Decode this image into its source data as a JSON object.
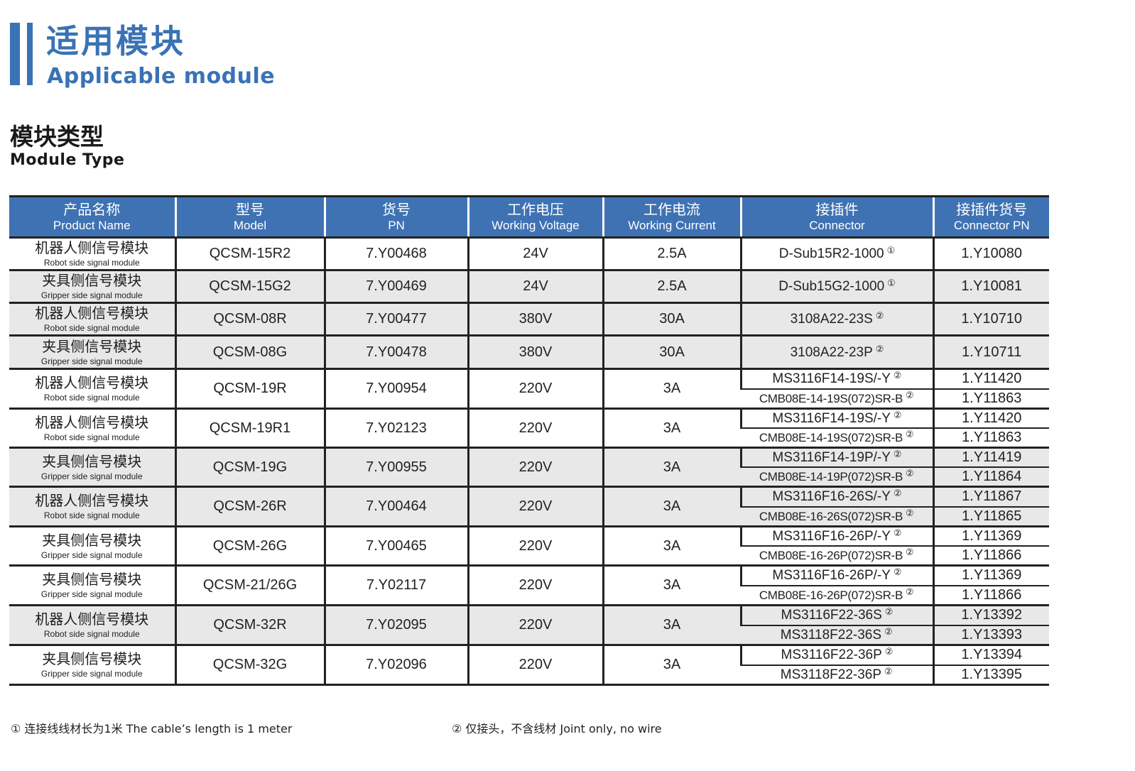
{
  "header": {
    "title_cn": "适用模块",
    "title_en": "Applicable module",
    "section_cn": "模块类型",
    "section_en": "Module Type"
  },
  "table": {
    "columns": [
      {
        "cn": "产品名称",
        "en": "Product Name"
      },
      {
        "cn": "型号",
        "en": "Model"
      },
      {
        "cn": "货号",
        "en": "PN"
      },
      {
        "cn": "工作电压",
        "en": "Working Voltage"
      },
      {
        "cn": "工作电流",
        "en": "Working Current"
      },
      {
        "cn": "接插件",
        "en": "Connector"
      },
      {
        "cn": "接插件货号",
        "en": "Connector PN"
      }
    ],
    "rows": [
      {
        "name_cn": "机器人侧信号模块",
        "name_en": "Robot side signal module",
        "model": "QCSM-15R2",
        "pn": "7.Y00468",
        "voltage": "24V",
        "current": "2.5A",
        "connectors": [
          {
            "name": "D-Sub15R2-1000",
            "note": "①",
            "pn": "1.Y10080"
          }
        ]
      },
      {
        "name_cn": "夹具侧信号模块",
        "name_en": "Gripper side signal module",
        "model": "QCSM-15G2",
        "pn": "7.Y00469",
        "voltage": "24V",
        "current": "2.5A",
        "connectors": [
          {
            "name": "D-Sub15G2-1000",
            "note": "①",
            "pn": "1.Y10081"
          }
        ]
      },
      {
        "name_cn": "机器人侧信号模块",
        "name_en": "Robot side signal module",
        "model": "QCSM-08R",
        "pn": "7.Y00477",
        "voltage": "380V",
        "current": "30A",
        "connectors": [
          {
            "name": "3108A22-23S",
            "note": "②",
            "pn": "1.Y10710"
          }
        ]
      },
      {
        "name_cn": "夹具侧信号模块",
        "name_en": "Gripper side signal module",
        "model": "QCSM-08G",
        "pn": "7.Y00478",
        "voltage": "380V",
        "current": "30A",
        "connectors": [
          {
            "name": "3108A22-23P",
            "note": "②",
            "pn": "1.Y10711"
          }
        ]
      },
      {
        "name_cn": "机器人侧信号模块",
        "name_en": "Robot side signal module",
        "model": "QCSM-19R",
        "pn": "7.Y00954",
        "voltage": "220V",
        "current": "3A",
        "connectors": [
          {
            "name": "MS3116F14-19S/-Y",
            "note": "②",
            "pn": "1.Y11420"
          },
          {
            "name": "CMB08E-14-19S(072)SR-B",
            "note": "②",
            "pn": "1.Y11863"
          }
        ]
      },
      {
        "name_cn": "机器人侧信号模块",
        "name_en": "Robot side signal module",
        "model": "QCSM-19R1",
        "pn": "7.Y02123",
        "voltage": "220V",
        "current": "3A",
        "connectors": [
          {
            "name": "MS3116F14-19S/-Y",
            "note": "②",
            "pn": "1.Y11420"
          },
          {
            "name": "CMB08E-14-19S(072)SR-B",
            "note": "②",
            "pn": "1.Y11863"
          }
        ]
      },
      {
        "name_cn": "夹具侧信号模块",
        "name_en": "Gripper side signal module",
        "model": "QCSM-19G",
        "pn": "7.Y00955",
        "voltage": "220V",
        "current": "3A",
        "connectors": [
          {
            "name": "MS3116F14-19P/-Y",
            "note": "②",
            "pn": "1.Y11419"
          },
          {
            "name": "CMB08E-14-19P(072)SR-B",
            "note": "②",
            "pn": "1.Y11864"
          }
        ]
      },
      {
        "name_cn": "机器人侧信号模块",
        "name_en": "Robot side signal module",
        "model": "QCSM-26R",
        "pn": "7.Y00464",
        "voltage": "220V",
        "current": "3A",
        "connectors": [
          {
            "name": "MS3116F16-26S/-Y",
            "note": "②",
            "pn": "1.Y11867"
          },
          {
            "name": "CMB08E-16-26S(072)SR-B",
            "note": "②",
            "pn": "1.Y11865"
          }
        ]
      },
      {
        "name_cn": "夹具侧信号模块",
        "name_en": "Gripper side signal module",
        "model": "QCSM-26G",
        "pn": "7.Y00465",
        "voltage": "220V",
        "current": "3A",
        "connectors": [
          {
            "name": "MS3116F16-26P/-Y",
            "note": "②",
            "pn": "1.Y11369"
          },
          {
            "name": "CMB08E-16-26P(072)SR-B",
            "note": "②",
            "pn": "1.Y11866"
          }
        ]
      },
      {
        "name_cn": "夹具侧信号模块",
        "name_en": "Gripper side signal module",
        "model": "QCSM-21/26G",
        "pn": "7.Y02117",
        "voltage": "220V",
        "current": "3A",
        "connectors": [
          {
            "name": "MS3116F16-26P/-Y",
            "note": "②",
            "pn": "1.Y11369"
          },
          {
            "name": "CMB08E-16-26P(072)SR-B",
            "note": "②",
            "pn": "1.Y11866"
          }
        ]
      },
      {
        "name_cn": "机器人侧信号模块",
        "name_en": "Robot side signal module",
        "model": "QCSM-32R",
        "pn": "7.Y02095",
        "voltage": "220V",
        "current": "3A",
        "connectors": [
          {
            "name": "MS3116F22-36S",
            "note": "②",
            "pn": "1.Y13392"
          },
          {
            "name": "MS3118F22-36S",
            "note": "②",
            "pn": "1.Y13393"
          }
        ]
      },
      {
        "name_cn": "夹具侧信号模块",
        "name_en": "Gripper side signal module",
        "model": "QCSM-32G",
        "pn": "7.Y02096",
        "voltage": "220V",
        "current": "3A",
        "connectors": [
          {
            "name": "MS3116F22-36P",
            "note": "②",
            "pn": "1.Y13394"
          },
          {
            "name": "MS3118F22-36P",
            "note": "②",
            "pn": "1.Y13395"
          }
        ]
      }
    ]
  },
  "footnotes": {
    "note1": "① 连接线线材长为1米 The cable’s length is 1 meter",
    "note2": "② 仅接头，不含线材 Joint only, no wire"
  }
}
